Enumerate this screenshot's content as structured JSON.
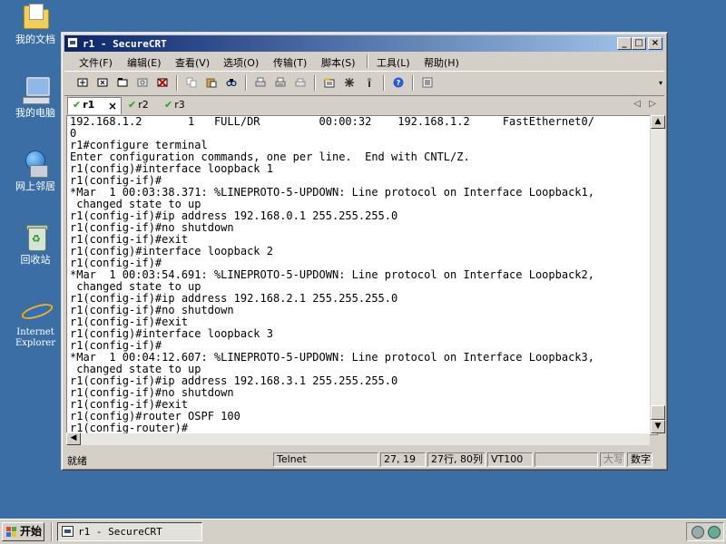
{
  "desktop": {
    "icons": [
      {
        "label": "我的文档",
        "icon": "my-documents-icon"
      },
      {
        "label": "我的电脑",
        "icon": "my-computer-icon"
      },
      {
        "label": "网上邻居",
        "icon": "network-places-icon"
      },
      {
        "label": "回收站",
        "icon": "recycle-bin-icon"
      },
      {
        "label": "Internet Explorer",
        "icon": "internet-explorer-icon"
      }
    ]
  },
  "window": {
    "title": "r1 - SecureCRT",
    "menu": [
      "文件(F)",
      "编辑(E)",
      "查看(V)",
      "选项(O)",
      "传输(T)",
      "脚本(S)",
      "工具(L)",
      "帮助(H)"
    ],
    "toolbar_icons": [
      "connect-icon",
      "quick-connect-icon",
      "connect-in-tab-icon",
      "reconnect-icon",
      "disconnect-icon",
      "copy-icon",
      "paste-icon",
      "find-icon",
      "print-icon",
      "print-selection-icon",
      "print-setup-icon",
      "session-options-icon",
      "global-options-icon",
      "keymap-icon",
      "help-icon",
      "sftp-icon"
    ],
    "tabs": [
      {
        "label": "r1",
        "active": true,
        "connected": true
      },
      {
        "label": "r2",
        "active": false,
        "connected": true
      },
      {
        "label": "r3",
        "active": false,
        "connected": true
      }
    ],
    "terminal_lines": [
      "192.168.1.2       1   FULL/DR         00:00:32    192.168.1.2     FastEthernet0/",
      "0",
      "r1#configure terminal",
      "Enter configuration commands, one per line.  End with CNTL/Z.",
      "r1(config)#interface loopback 1",
      "r1(config-if)#",
      "*Mar  1 00:03:38.371: %LINEPROTO-5-UPDOWN: Line protocol on Interface Loopback1,",
      " changed state to up",
      "r1(config-if)#ip address 192.168.0.1 255.255.255.0",
      "r1(config-if)#no shutdown",
      "r1(config-if)#exit",
      "r1(config)#interface loopback 2",
      "r1(config-if)#",
      "*Mar  1 00:03:54.691: %LINEPROTO-5-UPDOWN: Line protocol on Interface Loopback2,",
      " changed state to up",
      "r1(config-if)#ip address 192.168.2.1 255.255.255.0",
      "r1(config-if)#no shutdown",
      "r1(config-if)#exit",
      "r1(config)#interface loopback 3",
      "r1(config-if)#",
      "*Mar  1 00:04:12.607: %LINEPROTO-5-UPDOWN: Line protocol on Interface Loopback3,",
      " changed state to up",
      "r1(config-if)#ip address 192.168.3.1 255.255.255.0",
      "r1(config-if)#no shutdown",
      "r1(config-if)#exit",
      "r1(config)#router OSPF 100",
      "r1(config-router)#"
    ],
    "status": {
      "ready": "就绪",
      "protocol": "Telnet",
      "cursor": "27, 19",
      "size": "27行, 80列",
      "emulation": "VT100",
      "empty": "",
      "caps": "大写",
      "num": "数字"
    }
  },
  "taskbar": {
    "start_label": "开始",
    "task_label": "r1 - SecureCRT"
  },
  "colors": {
    "desktop": "#3a6ea5",
    "title_active_start": "#0a246a",
    "title_active_end": "#a6caf0",
    "connected_check": "#2aa12a"
  }
}
